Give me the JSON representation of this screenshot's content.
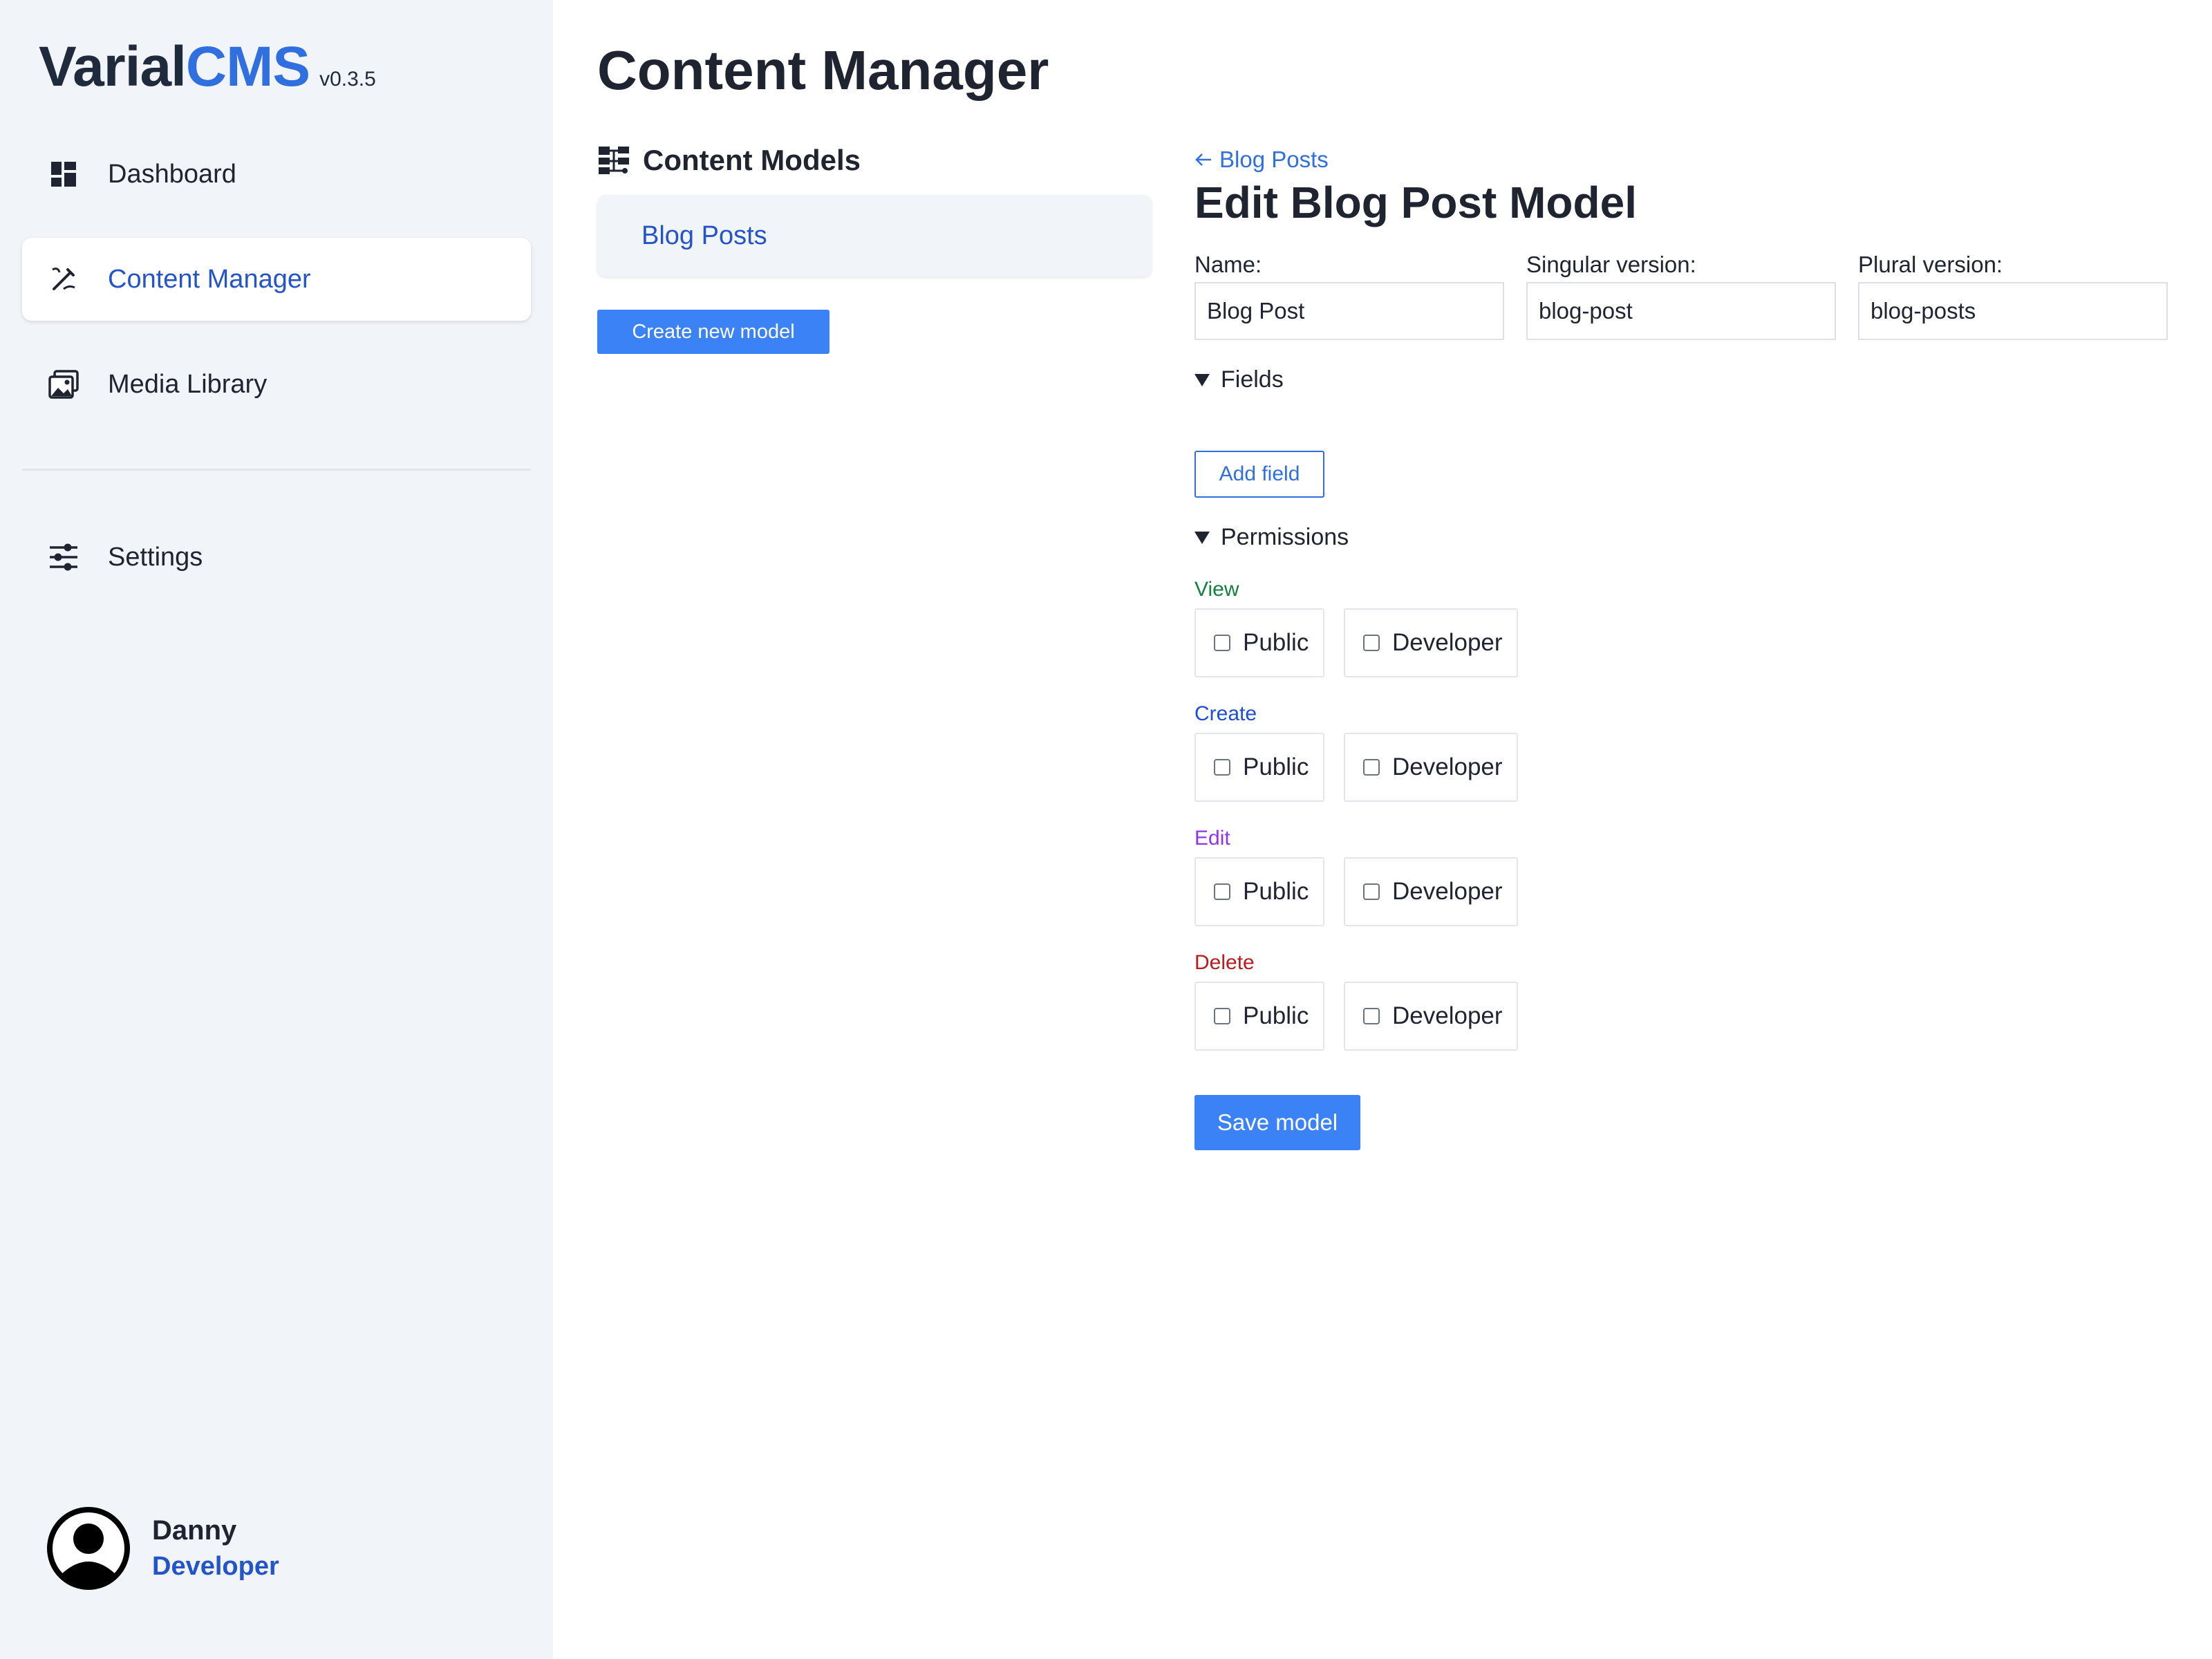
{
  "brand": {
    "name_part1": "Varial",
    "name_part2": "CMS",
    "version": "v0.3.5"
  },
  "nav": {
    "items": [
      {
        "label": "Dashboard",
        "icon": "dashboard-grid-icon"
      },
      {
        "label": "Content Manager",
        "icon": "pen-edit-icon",
        "active": true
      },
      {
        "label": "Media Library",
        "icon": "images-icon"
      },
      {
        "label": "Settings",
        "icon": "sliders-icon"
      }
    ]
  },
  "user": {
    "name": "Danny",
    "role": "Developer"
  },
  "page": {
    "title": "Content Manager"
  },
  "models": {
    "heading": "Content Models",
    "items": [
      "Blog Posts"
    ],
    "create_label": "Create new model"
  },
  "editor": {
    "back_label": "Blog Posts",
    "title": "Edit Blog Post Model",
    "fields": {
      "name_label": "Name:",
      "name_value": "Blog Post",
      "singular_label": "Singular version:",
      "singular_value": "blog-post",
      "plural_label": "Plural version:",
      "plural_value": "blog-posts"
    },
    "fields_section": "Fields",
    "add_field_label": "Add field",
    "permissions_section": "Permissions",
    "permissions": [
      {
        "label": "View",
        "color": "#15803d",
        "options": [
          "Public",
          "Developer"
        ]
      },
      {
        "label": "Create",
        "color": "#1d4ed8",
        "options": [
          "Public",
          "Developer"
        ]
      },
      {
        "label": "Edit",
        "color": "#9333ea",
        "options": [
          "Public",
          "Developer"
        ]
      },
      {
        "label": "Delete",
        "color": "#b91c1c",
        "options": [
          "Public",
          "Developer"
        ]
      }
    ],
    "save_label": "Save model"
  },
  "colors": {
    "accent": "#3b82f6",
    "link": "#2454c9",
    "sidebar_bg": "#f1f4f8"
  }
}
